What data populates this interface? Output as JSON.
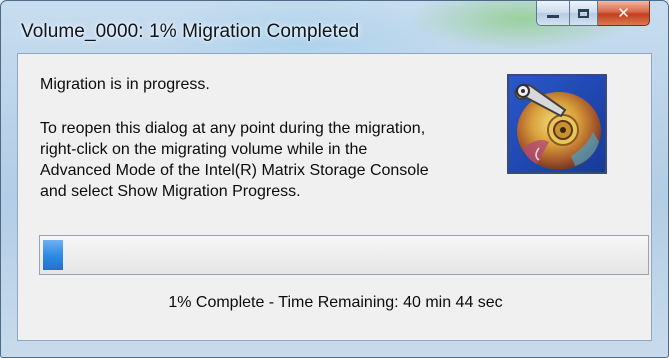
{
  "window": {
    "title": "Volume_0000: 1% Migration Completed",
    "controls": {
      "minimize_icon": "minimize-icon",
      "maximize_icon": "maximize-icon",
      "close_icon": "close-icon",
      "close_glyph": "✕"
    }
  },
  "dialog": {
    "message_primary": "Migration is in progress.",
    "message_secondary": "To reopen this dialog at any point during the migration, right-click on the migrating volume while in the Advanced Mode of the Intel(R) Matrix Storage Console and select Show Migration Progress.",
    "icon": "hard-disk-icon"
  },
  "progress": {
    "percent": 1,
    "status_text": "1% Complete - Time Remaining: 40 min 44 sec"
  },
  "colors": {
    "progress_fill": "#2f8be3",
    "close_button": "#c2401f",
    "dialog_background": "#f0f0f0",
    "title_glass": "#b3cde6"
  }
}
